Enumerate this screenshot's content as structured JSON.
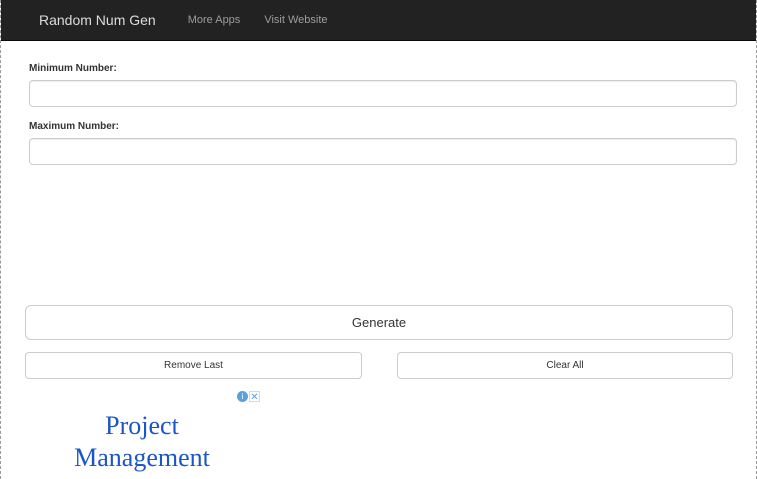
{
  "navbar": {
    "brand": "Random Num Gen",
    "links": [
      {
        "label": "More Apps"
      },
      {
        "label": "Visit Website"
      }
    ]
  },
  "form": {
    "min": {
      "label": "Minimum Number:",
      "value": "",
      "placeholder": ""
    },
    "max": {
      "label": "Maximum Number:",
      "value": "",
      "placeholder": ""
    }
  },
  "buttons": {
    "generate": "Generate",
    "remove_last": "Remove Last",
    "clear_all": "Clear All"
  },
  "ad": {
    "info_glyph": "i",
    "close_glyph": "✕",
    "line1": "Project",
    "line2": "Management",
    "color": "#1a56c8"
  },
  "colors": {
    "navbar_bg": "#222222",
    "brand_text": "#dcdcdc",
    "nav_link_text": "#9d9d9d"
  }
}
